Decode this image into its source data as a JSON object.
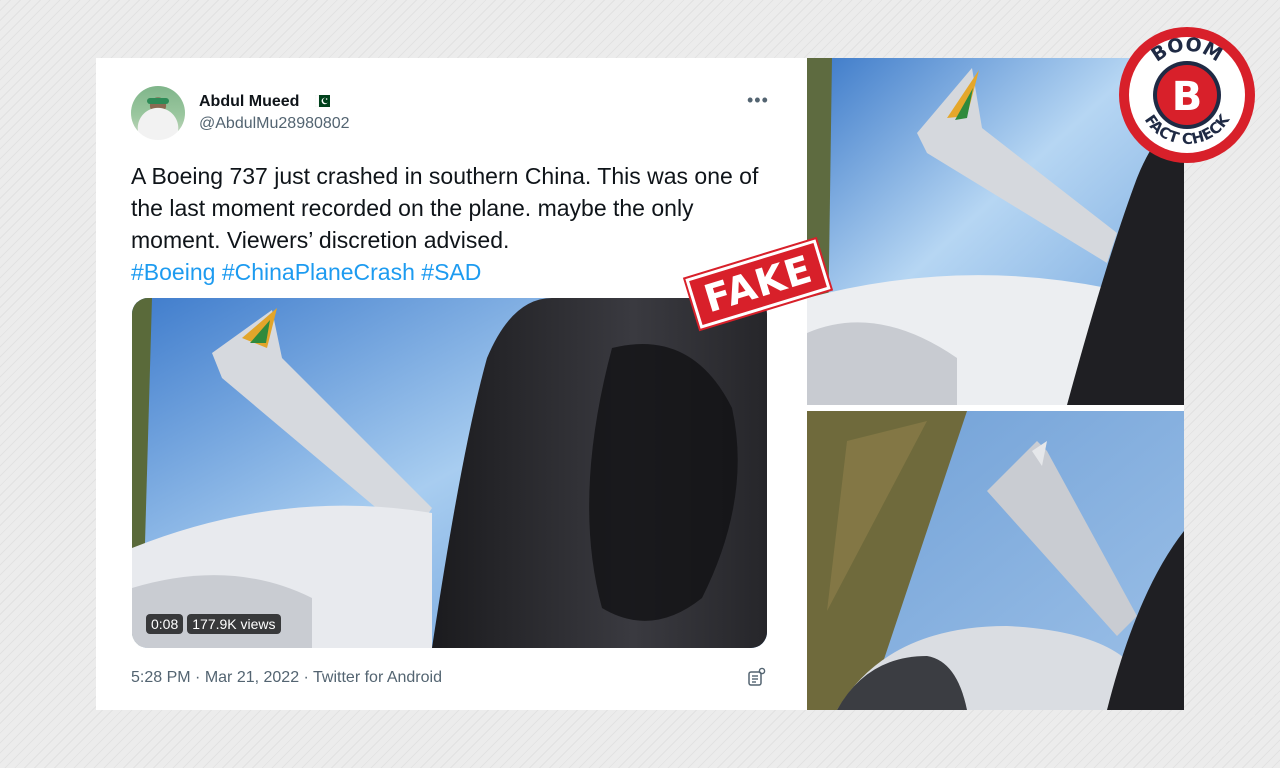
{
  "tweet": {
    "display_name": "Abdul Mueed",
    "flag_icon": "pakistan-flag-icon",
    "handle": "@AbdulMu28980802",
    "text": "A Boeing 737 just crashed in southern China. This was one of the last moment recorded on the plane. maybe the only moment. Viewers’ discretion advised.",
    "hashtags": [
      "#Boeing",
      "#ChinaPlaneCrash",
      "#SAD"
    ],
    "video": {
      "duration": "0:08",
      "views": "177.9K views"
    },
    "time": "5:28 PM",
    "separator": " · ",
    "date": "Mar 21, 2022",
    "source": "Twitter for Android"
  },
  "stamp": {
    "label": "FAKE",
    "color": "#d8202a"
  },
  "logo": {
    "top_text": "BOOM",
    "bottom_text": "FACT CHECK",
    "letter": "B",
    "color": "#d8202a"
  },
  "colors": {
    "link": "#1d9bf0",
    "secondary_text": "#536471",
    "primary_text": "#0f1419"
  }
}
